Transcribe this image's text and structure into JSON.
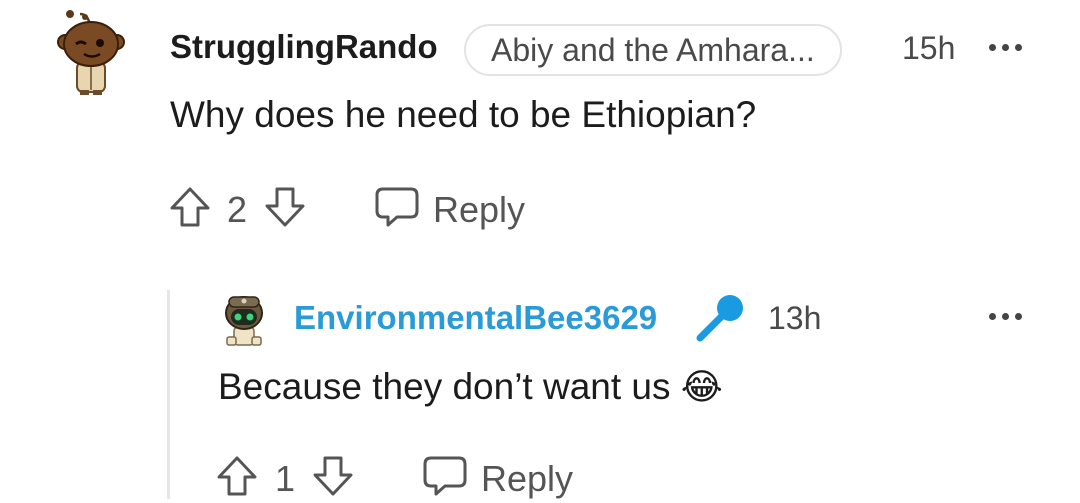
{
  "comment": {
    "username": "StrugglingRando",
    "flair": "Abiy and the Amhara...",
    "time": "15h",
    "body": "Why does he need to be Ethiopian?",
    "upvotes": "2",
    "reply_label": "Reply",
    "more_icon": "more-dots-icon"
  },
  "reply": {
    "username": "EnvironmentalBee3629",
    "badge_icon": "microphone-icon",
    "time": "13h",
    "body": "Because they don’t want us",
    "emoji": "😂",
    "upvotes": "1",
    "reply_label": "Reply",
    "more_icon": "more-dots-icon"
  },
  "colors": {
    "username_reply": "#2a9bd6",
    "mic_icon": "#1a9ae0",
    "text": "#1c1c1c",
    "muted": "#4a4a4a"
  }
}
